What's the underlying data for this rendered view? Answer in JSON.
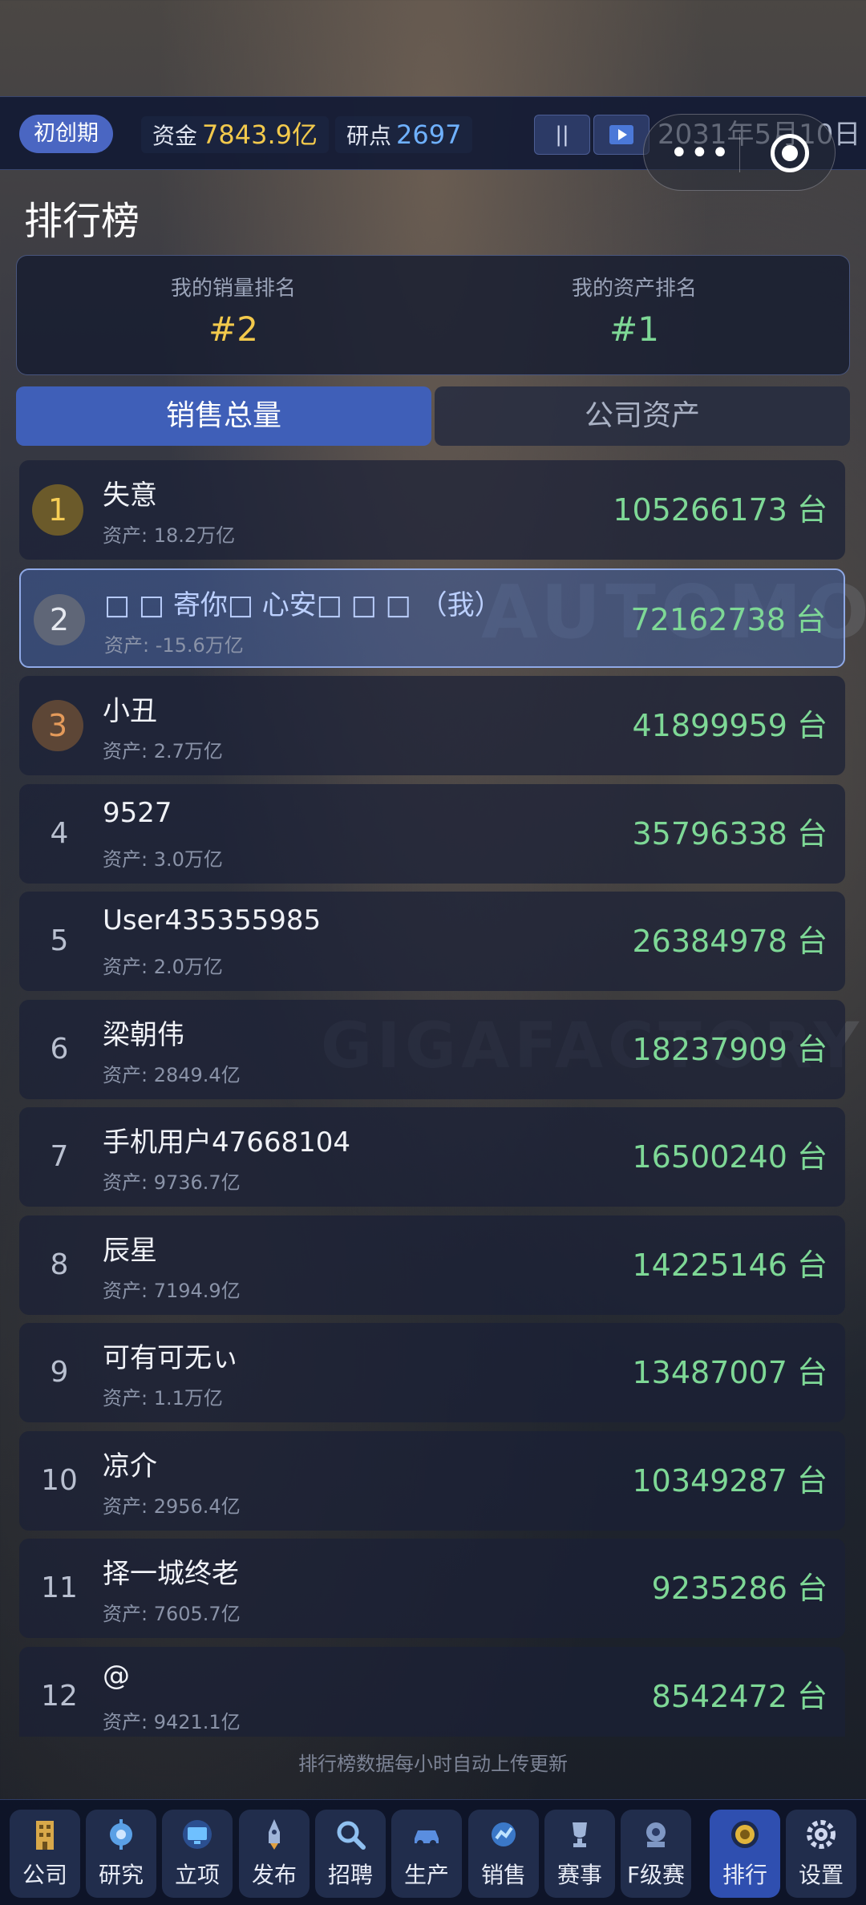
{
  "status": {
    "phase": "初创期",
    "funds_label": "资金",
    "funds_value": "7843.9亿",
    "research_label": "研点",
    "research_value": "2697",
    "pause_label": "||",
    "date": "2031年5月10日"
  },
  "page_title": "排行榜",
  "my_ranks": {
    "sales_label": "我的销量排名",
    "sales_rank": "#2",
    "assets_label": "我的资产排名",
    "assets_rank": "#1"
  },
  "tabs": {
    "sales": "销售总量",
    "assets": "公司资产"
  },
  "leaderboard": [
    {
      "rank": "1",
      "name": "失意",
      "asset": "资产: 18.2万亿",
      "sales": "105266173 台"
    },
    {
      "rank": "2",
      "name": "□ □ 寄你□ 心安□ □ □ （我）",
      "asset": "资产: -15.6万亿",
      "sales": "72162738 台"
    },
    {
      "rank": "3",
      "name": "小丑",
      "asset": "资产: 2.7万亿",
      "sales": "41899959 台"
    },
    {
      "rank": "4",
      "name": "9527",
      "asset": "资产: 3.0万亿",
      "sales": "35796338 台"
    },
    {
      "rank": "5",
      "name": "User435355985",
      "asset": "资产: 2.0万亿",
      "sales": "26384978 台"
    },
    {
      "rank": "6",
      "name": "梁朝伟",
      "asset": "资产: 2849.4亿",
      "sales": "18237909 台"
    },
    {
      "rank": "7",
      "name": "手机用户47668104",
      "asset": "资产: 9736.7亿",
      "sales": "16500240 台"
    },
    {
      "rank": "8",
      "name": "辰星",
      "asset": "资产: 7194.9亿",
      "sales": "14225146 台"
    },
    {
      "rank": "9",
      "name": "可有可无ぃ",
      "asset": "资产: 1.1万亿",
      "sales": "13487007 台"
    },
    {
      "rank": "10",
      "name": "凉介",
      "asset": "资产: 2956.4亿",
      "sales": "10349287 台"
    },
    {
      "rank": "11",
      "name": "择一城终老",
      "asset": "资产: 7605.7亿",
      "sales": "9235286 台"
    },
    {
      "rank": "12",
      "name": "@",
      "asset": "资产: 9421.1亿",
      "sales": "8542472 台"
    }
  ],
  "footnote": "排行榜数据每小时自动上传更新",
  "nav": [
    {
      "label": "公司",
      "icon": "building-icon"
    },
    {
      "label": "研究",
      "icon": "research-icon"
    },
    {
      "label": "立项",
      "icon": "monitor-icon"
    },
    {
      "label": "发布",
      "icon": "rocket-icon"
    },
    {
      "label": "招聘",
      "icon": "magnifier-icon"
    },
    {
      "label": "生产",
      "icon": "car-icon"
    },
    {
      "label": "销售",
      "icon": "sales-icon"
    },
    {
      "label": "赛事",
      "icon": "trophy-icon"
    },
    {
      "label": "F级赛",
      "icon": "race-icon"
    },
    {
      "label": "排行",
      "icon": "medal-icon"
    },
    {
      "label": "设置",
      "icon": "gear-icon"
    }
  ],
  "colors": {
    "accent": "#3f5fb8",
    "gold": "#f2c94c",
    "green": "#7ed896",
    "research_blue": "#6fb1ff"
  }
}
